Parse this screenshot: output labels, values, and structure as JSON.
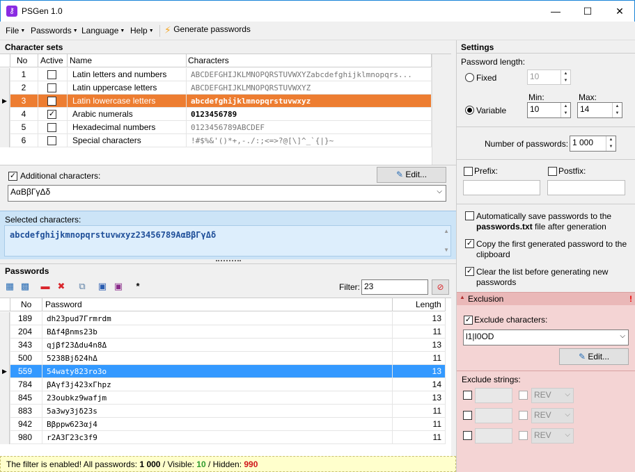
{
  "window": {
    "title": "PSGen 1.0",
    "minimize": "—",
    "maximize": "☐",
    "close": "✕"
  },
  "menu": {
    "file": "File",
    "passwords": "Passwords",
    "language": "Language",
    "help": "Help",
    "generate": "Generate passwords"
  },
  "charsets": {
    "heading": "Character sets",
    "columns": {
      "no": "No",
      "active": "Active",
      "name": "Name",
      "characters": "Characters"
    },
    "rows": [
      {
        "no": "1",
        "active": false,
        "name": "Latin letters and numbers",
        "chars": "ABCDEFGHIJKLMNOPQRSTUVWXYZabcdefghijklmnopqrs..."
      },
      {
        "no": "2",
        "active": false,
        "name": "Latin uppercase letters",
        "chars": "ABCDEFGHIJKLMNOPQRSTUVWXYZ"
      },
      {
        "no": "3",
        "active": true,
        "name": "Latin lowercase letters",
        "chars": "abcdefghijklmnopqrstuvwxyz"
      },
      {
        "no": "4",
        "active": true,
        "name": "Arabic numerals",
        "chars": "0123456789"
      },
      {
        "no": "5",
        "active": false,
        "name": "Hexadecimal numbers",
        "chars": "0123456789ABCDEF"
      },
      {
        "no": "6",
        "active": false,
        "name": "Special characters",
        "chars": "!#$%&'()*+,-./:;<=>?@[\\]^_`{|}~"
      }
    ],
    "additional_label": "Additional characters:",
    "additional_value": "AαΒβΓγΔδ",
    "edit_label": "Edit...",
    "selected_label": "Selected characters:",
    "selected_value": "abcdefghijkmnopqrstuvwxyz23456789AαΒβΓγΔδ"
  },
  "passwords": {
    "heading": "Passwords",
    "filter_label": "Filter:",
    "filter_value": "23",
    "columns": {
      "no": "No",
      "password": "Password",
      "length": "Length"
    },
    "rows": [
      {
        "no": "189",
        "pw": "dh23pud7Γrmrdm",
        "len": "13"
      },
      {
        "no": "204",
        "pw": "BΔf4βnms23b",
        "len": "11"
      },
      {
        "no": "343",
        "pw": "qjβf23Δdu4n8Δ",
        "len": "13"
      },
      {
        "no": "500",
        "pw": "5238Bjδ24hΔ",
        "len": "11"
      },
      {
        "no": "559",
        "pw": "54waty823ro3o",
        "len": "13"
      },
      {
        "no": "784",
        "pw": "βAγf3j423xΓhpz",
        "len": "14"
      },
      {
        "no": "845",
        "pw": "23oubkz9wafjm",
        "len": "13"
      },
      {
        "no": "883",
        "pw": "5a3wy3jδ23s",
        "len": "11"
      },
      {
        "no": "942",
        "pw": "Bβppw623αj4",
        "len": "11"
      },
      {
        "no": "980",
        "pw": "r2A3Γ23c3f9",
        "len": "11"
      }
    ],
    "selected_index": 4
  },
  "status": {
    "prefix": "The filter is enabled!  All passwords:",
    "all": "1 000",
    "visible_label": "/  Visible:",
    "visible": "10",
    "hidden_label": "/  Hidden:",
    "hidden": "990"
  },
  "settings": {
    "heading": "Settings",
    "length_label": "Password length:",
    "fixed_label": "Fixed",
    "fixed_value": "10",
    "variable_label": "Variable",
    "min_label": "Min:",
    "min_value": "10",
    "max_label": "Max:",
    "max_value": "14",
    "count_label": "Number of passwords:",
    "count_value": "1 000",
    "prefix_label": "Prefix:",
    "postfix_label": "Postfix:",
    "autosave_1": "Automatically save passwords to the",
    "autosave_file": "passwords.txt",
    "autosave_2": "file after generation",
    "copy_1": "Copy the first generated password to the",
    "copy_2": "clipboard",
    "clear_1": "Clear the list before generating new",
    "clear_2": "passwords"
  },
  "exclusion": {
    "heading": "Exclusion",
    "alert": "!",
    "chars_label": "Exclude characters:",
    "chars_value": "l1|I0OD",
    "edit_label": "Edit...",
    "strings_label": "Exclude strings:",
    "rev": "REV"
  },
  "colors": {
    "selected_row": "#ed7d31",
    "selected_pw_row": "#3399ff",
    "exclusion_bg": "#f4d4d4",
    "status_bg": "#ffffcc"
  }
}
